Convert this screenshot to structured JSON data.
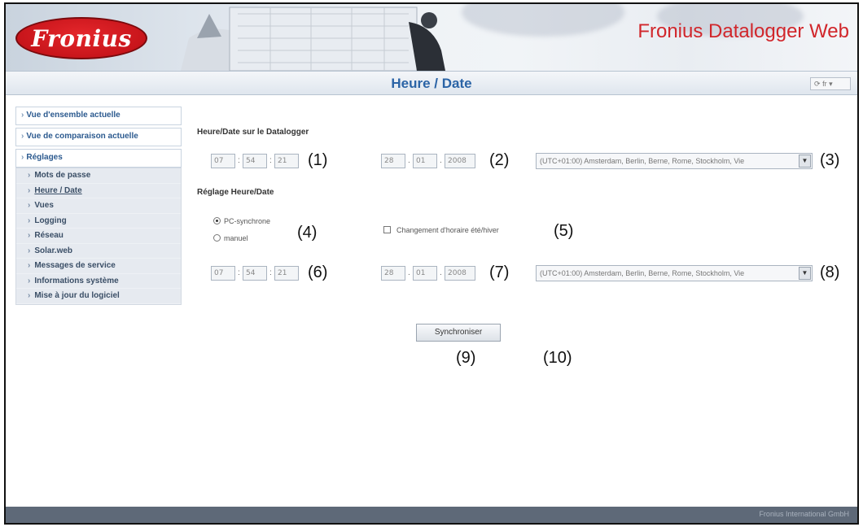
{
  "header": {
    "logo_text": "Fronius",
    "brand_title": "Fronius Datalogger Web",
    "brand_color": "#d1262b"
  },
  "titlebar": {
    "title": "Heure / Date",
    "language": "fr"
  },
  "sidebar": {
    "items": [
      {
        "label": "Vue d'ensemble actuelle"
      },
      {
        "label": "Vue de comparaison actuelle"
      },
      {
        "label": "Réglages"
      }
    ],
    "sub_items": [
      {
        "label": "Mots de passe"
      },
      {
        "label": "Heure / Date"
      },
      {
        "label": "Vues"
      },
      {
        "label": "Logging"
      },
      {
        "label": "Réseau"
      },
      {
        "label": "Solar.web"
      },
      {
        "label": "Messages de service"
      },
      {
        "label": "Informations système"
      },
      {
        "label": "Mise à jour du logiciel"
      }
    ]
  },
  "datalogger": {
    "heading": "Heure/Date sur le Datalogger",
    "hour": "07",
    "minute": "54",
    "second": "21",
    "day": "28",
    "month": "01",
    "year": "2008",
    "timezone": "(UTC+01:00) Amsterdam, Berlin, Berne, Rome, Stockholm, Vie"
  },
  "settings": {
    "heading": "Réglage Heure/Date",
    "option_pc_sync": "PC-synchrone",
    "option_manual": "manuel",
    "dst_label": "Changement d'horaire été/hiver",
    "hour": "07",
    "minute": "54",
    "second": "21",
    "day": "28",
    "month": "01",
    "year": "2008",
    "timezone": "(UTC+01:00) Amsterdam, Berlin, Berne, Rome, Stockholm, Vie",
    "sync_button": "Synchroniser"
  },
  "callouts": [
    "(1)",
    "(2)",
    "(3)",
    "(4)",
    "(5)",
    "(6)",
    "(7)",
    "(8)",
    "(9)",
    "(10)"
  ],
  "footer": {
    "text": "Fronius International GmbH"
  }
}
